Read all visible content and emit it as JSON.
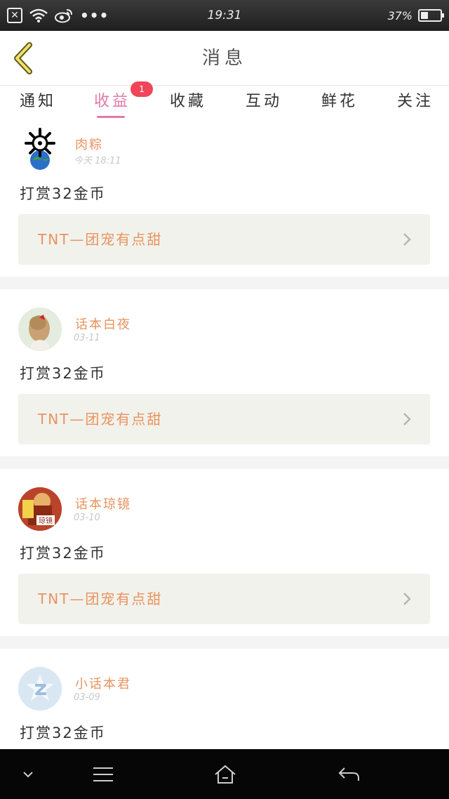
{
  "status_bar": {
    "time": "19:31",
    "battery_text": "37%",
    "battery_level": 0.37,
    "dots": "•••"
  },
  "header": {
    "title": "消息"
  },
  "tabs": [
    {
      "label": "通知",
      "active": false
    },
    {
      "label": "收益",
      "active": true,
      "badge": "1"
    },
    {
      "label": "收藏",
      "active": false
    },
    {
      "label": "互动",
      "active": false
    },
    {
      "label": "鲜花",
      "active": false
    },
    {
      "label": "关注",
      "active": false
    }
  ],
  "messages": [
    {
      "user": "肉粽",
      "time": "今天 18:11",
      "reward": "打赏32金币",
      "link": "TNT—团宠有点甜"
    },
    {
      "user": "话本白夜",
      "time": "03-11",
      "reward": "打赏32金币",
      "link": "TNT—团宠有点甜"
    },
    {
      "user": "话本琼镜",
      "time": "03-10",
      "reward": "打赏32金币",
      "link": "TNT—团宠有点甜"
    },
    {
      "user": "小话本君",
      "time": "03-09",
      "reward": "打赏32金币"
    }
  ],
  "avatar3_label": "琼镜",
  "colors": {
    "accent_pink": "#e07aa6",
    "accent_orange": "#e8935f",
    "badge_red": "#f0455a"
  }
}
